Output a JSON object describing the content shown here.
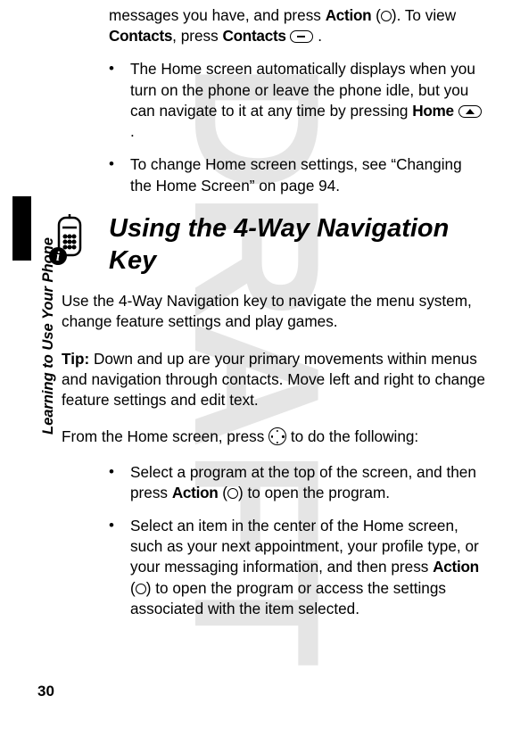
{
  "watermark": "DRAFT",
  "side_label": "Learning to Use Your Phone",
  "page_number": "30",
  "intro": {
    "frag1": "messages you have, and press ",
    "action": "Action",
    "frag2": " (",
    "frag3": "). To view ",
    "contacts1": "Contacts",
    "frag4": ", press ",
    "contacts2": "Contacts",
    "frag5": " ",
    "frag6": " ."
  },
  "bullets_top": [
    {
      "p1": "The Home screen automatically displays when you turn on the phone or leave the phone idle, but you can navigate to it at any time by pressing ",
      "home": "Home",
      "p2": " ",
      "p3": " ."
    },
    {
      "p1": "To change Home screen settings, see “Changing the Home Screen” on page 94."
    }
  ],
  "section_title": "Using the 4-Way Navigation Key",
  "para1": "Use the 4-Way Navigation key to navigate the menu system, change feature settings and play games.",
  "tip_label": "Tip:",
  "tip_text": " Down and up are your primary movements within menus and navigation through contacts. Move left and right to change feature settings and edit text.",
  "para2a": "From the Home screen, press ",
  "para2b": " to do the following:",
  "bullets_bottom": [
    {
      "p1": "Select a program at the top of the screen, and then press ",
      "action": "Action",
      "p2": " (",
      "p3": ") to open the program."
    },
    {
      "p1": "Select an item in the center of the Home screen, such as your next appointment, your profile type, or your messaging information, and then press ",
      "action": "Action",
      "p2": " (",
      "p3": ") to open the program or access the settings associated with the item selected."
    }
  ]
}
